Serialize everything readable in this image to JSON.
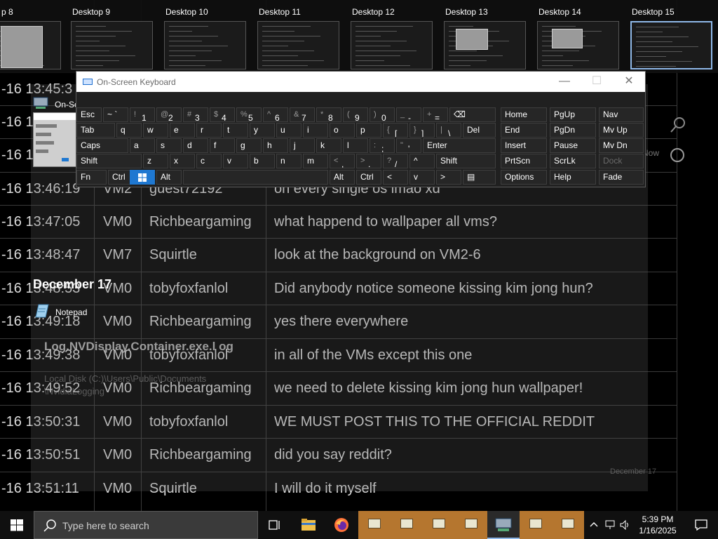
{
  "taskbar": {
    "search_placeholder": "Type here to search",
    "clock_time": "5:39 PM",
    "clock_date": "1/16/2025"
  },
  "desktops": [
    {
      "label": "p 8"
    },
    {
      "label": "Desktop 9"
    },
    {
      "label": "Desktop 10"
    },
    {
      "label": "Desktop 11"
    },
    {
      "label": "Desktop 12"
    },
    {
      "label": "Desktop 13"
    },
    {
      "label": "Desktop 14"
    },
    {
      "label": "Desktop 15"
    }
  ],
  "task_view": {
    "osk_window_title": "On-Sc",
    "group_label": "December 17",
    "notepad_label": "Notepad",
    "recent_file": "Log.NVDisplay.Container.exe.l og",
    "recent_path": "Local Disk (C:)\\Users\\Public\\Documents",
    "recent_folder": "\\NvidiaLogging",
    "faint_date": "December 17",
    "now_label": "Now"
  },
  "osk": {
    "title": "On-Screen Keyboard",
    "rows": [
      [
        {
          "label": "Esc"
        },
        {
          "label": "~ `"
        },
        {
          "shift": "!",
          "label": "1"
        },
        {
          "shift": "@",
          "label": "2"
        },
        {
          "shift": "#",
          "label": "3"
        },
        {
          "shift": "$",
          "label": "4"
        },
        {
          "shift": "%",
          "label": "5"
        },
        {
          "shift": "^",
          "label": "6"
        },
        {
          "shift": "&",
          "label": "7"
        },
        {
          "shift": "*",
          "label": "8"
        },
        {
          "shift": "(",
          "label": "9"
        },
        {
          "shift": ")",
          "label": "0"
        },
        {
          "shift": "_",
          "label": "-"
        },
        {
          "shift": "+",
          "label": "="
        },
        {
          "label": "⌫"
        },
        {
          "label": "Home"
        },
        {
          "label": "PgUp"
        },
        {
          "label": "Nav"
        }
      ],
      [
        {
          "label": "Tab"
        },
        {
          "label": "q"
        },
        {
          "label": "w"
        },
        {
          "label": "e"
        },
        {
          "label": "r"
        },
        {
          "label": "t"
        },
        {
          "label": "y"
        },
        {
          "label": "u"
        },
        {
          "label": "i"
        },
        {
          "label": "o"
        },
        {
          "label": "p"
        },
        {
          "shift": "{",
          "label": "["
        },
        {
          "shift": "}",
          "label": "]"
        },
        {
          "shift": "|",
          "label": "\\"
        },
        {
          "label": "Del"
        },
        {
          "label": "End"
        },
        {
          "label": "PgDn"
        },
        {
          "label": "Mv Up"
        }
      ],
      [
        {
          "label": "Caps"
        },
        {
          "label": "a"
        },
        {
          "label": "s"
        },
        {
          "label": "d"
        },
        {
          "label": "f"
        },
        {
          "label": "g"
        },
        {
          "label": "h"
        },
        {
          "label": "j"
        },
        {
          "label": "k"
        },
        {
          "label": "l"
        },
        {
          "shift": ":",
          "label": ";"
        },
        {
          "shift": "\"",
          "label": "'"
        },
        {
          "label": "Enter"
        },
        {
          "label": "Insert"
        },
        {
          "label": "Pause"
        },
        {
          "label": "Mv Dn"
        }
      ],
      [
        {
          "label": "Shift"
        },
        {
          "label": "z"
        },
        {
          "label": "x"
        },
        {
          "label": "c"
        },
        {
          "label": "v"
        },
        {
          "label": "b"
        },
        {
          "label": "n"
        },
        {
          "label": "m"
        },
        {
          "shift": "<",
          "label": ","
        },
        {
          "shift": ">",
          "label": "."
        },
        {
          "shift": "?",
          "label": "/"
        },
        {
          "label": "^"
        },
        {
          "label": "Shift"
        },
        {
          "label": "PrtScn"
        },
        {
          "label": "ScrLk"
        },
        {
          "label": "Dock"
        }
      ],
      [
        {
          "label": "Fn"
        },
        {
          "label": "Ctrl"
        },
        {
          "label": "win"
        },
        {
          "label": "Alt"
        },
        {
          "label": ""
        },
        {
          "label": "Alt"
        },
        {
          "label": "Ctrl"
        },
        {
          "label": "<"
        },
        {
          "label": "v"
        },
        {
          "label": ">"
        },
        {
          "label": "▤"
        },
        {
          "label": "Options"
        },
        {
          "label": "Help"
        },
        {
          "label": "Fade"
        }
      ]
    ]
  },
  "chat": {
    "rows": [
      {
        "time": "-16 13:45:3",
        "vm": "",
        "user": "",
        "msg": ""
      },
      {
        "time": "-16 1",
        "vm": "",
        "user": "",
        "msg": ""
      },
      {
        "time": "-16 1",
        "vm": "",
        "user": "",
        "msg": ""
      },
      {
        "time": "-16 13:46:19",
        "vm": "VM2",
        "user": "guest72192",
        "msg": "on every single os lmao xd"
      },
      {
        "time": "-16 13:47:05",
        "vm": "VM0",
        "user": "Richbeargaming",
        "msg": "what happend to wallpaper all vms?"
      },
      {
        "time": "-16 13:48:47",
        "vm": "VM7",
        "user": "Squirtle",
        "msg": "look at the background on VM2-6"
      },
      {
        "time": "-16 13:48:53",
        "vm": "VM0",
        "user": "tobyfoxfanlol",
        "msg": "Did anybody notice someone kissing kim jong hun?"
      },
      {
        "time": "-16 13:49:18",
        "vm": "VM0",
        "user": "Richbeargaming",
        "msg": "yes there everywhere"
      },
      {
        "time": "-16 13:49:38",
        "vm": "VM0",
        "user": "tobyfoxfanlol",
        "msg": "in all of the VMs except this one"
      },
      {
        "time": "-16 13:49:52",
        "vm": "VM0",
        "user": "Richbeargaming",
        "msg": "we need to delete kissing kim jong hun wallpaper!"
      },
      {
        "time": "-16 13:50:31",
        "vm": "VM0",
        "user": "tobyfoxfanlol",
        "msg": "WE MUST POST THIS TO THE OFFICIAL REDDIT"
      },
      {
        "time": "-16 13:50:51",
        "vm": "VM0",
        "user": "Richbeargaming",
        "msg": "did you say reddit?"
      },
      {
        "time": "-16 13:51:11",
        "vm": "VM0",
        "user": "Squirtle",
        "msg": "I will do it myself"
      }
    ]
  }
}
